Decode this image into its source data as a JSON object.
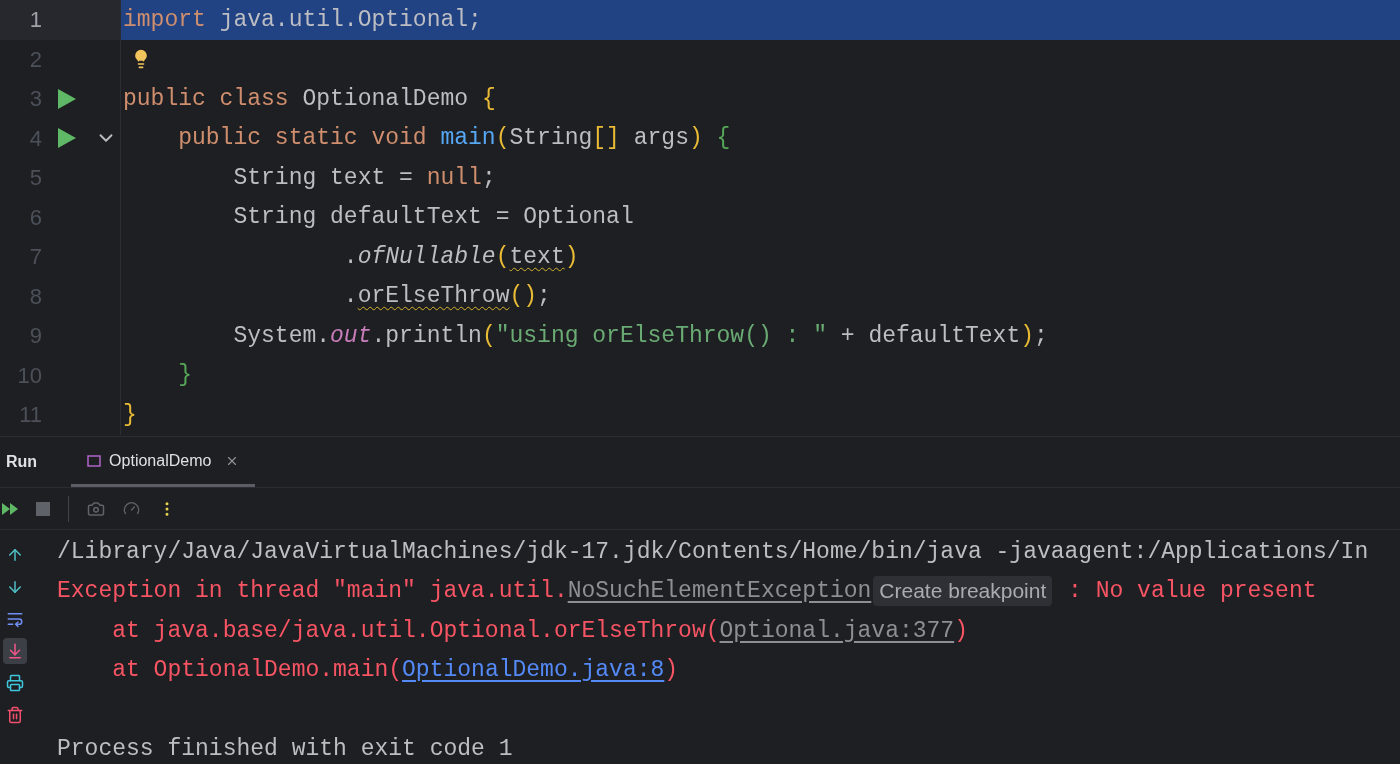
{
  "editor": {
    "lines": [
      {
        "number": "1",
        "selected": true,
        "run": false,
        "fold": false,
        "tokens": [
          {
            "text": "import",
            "kind": "keyword"
          },
          {
            "text": " java.util.Optional;",
            "kind": "plain"
          }
        ]
      },
      {
        "number": "2",
        "selected": false,
        "run": false,
        "fold": false,
        "bulb": true
      },
      {
        "number": "3",
        "selected": false,
        "run": true,
        "fold": false,
        "tokens": [
          {
            "text": "public class",
            "kind": "keyword"
          },
          {
            "text": " OptionalDemo ",
            "kind": "plain"
          },
          {
            "text": "{",
            "kind": "bracket1"
          }
        ]
      },
      {
        "number": "4",
        "selected": false,
        "run": true,
        "fold": true,
        "tokens": [
          {
            "text": "    public static void ",
            "kind": "keyword"
          },
          {
            "text": "main",
            "kind": "declaration"
          },
          {
            "text": "(",
            "kind": "bracket1"
          },
          {
            "text": "String",
            "kind": "plain"
          },
          {
            "text": "[]",
            "kind": "bracket1"
          },
          {
            "text": " args",
            "kind": "plain"
          },
          {
            "text": ")",
            "kind": "bracket1"
          },
          {
            "text": " {",
            "kind": "bracket2"
          }
        ]
      },
      {
        "number": "5",
        "selected": false,
        "run": false,
        "fold": false,
        "tokens": [
          {
            "text": "        String text = ",
            "kind": "plain"
          },
          {
            "text": "null",
            "kind": "keyword"
          },
          {
            "text": ";",
            "kind": "plain"
          }
        ]
      },
      {
        "number": "6",
        "selected": false,
        "run": false,
        "fold": false,
        "tokens": [
          {
            "text": "        String defaultText = Optional",
            "kind": "plain"
          }
        ]
      },
      {
        "number": "7",
        "selected": false,
        "run": false,
        "fold": false,
        "tokens": [
          {
            "text": "                .",
            "kind": "plain"
          },
          {
            "text": "ofNullable",
            "kind": "call"
          },
          {
            "text": "(",
            "kind": "bracket1"
          },
          {
            "text": "text",
            "kind": "plain",
            "warning": true
          },
          {
            "text": ")",
            "kind": "bracket1"
          }
        ]
      },
      {
        "number": "8",
        "selected": false,
        "run": false,
        "fold": false,
        "tokens": [
          {
            "text": "                .",
            "kind": "plain"
          },
          {
            "text": "orElseThrow",
            "kind": "plain",
            "warning": true
          },
          {
            "text": "()",
            "kind": "bracket1"
          },
          {
            "text": ";",
            "kind": "plain"
          }
        ]
      },
      {
        "number": "9",
        "selected": false,
        "run": false,
        "fold": false,
        "tokens": [
          {
            "text": "        System.",
            "kind": "plain"
          },
          {
            "text": "out",
            "kind": "field"
          },
          {
            "text": ".println",
            "kind": "plain"
          },
          {
            "text": "(",
            "kind": "bracket1"
          },
          {
            "text": "\"using orElseThrow() : \"",
            "kind": "string"
          },
          {
            "text": " + defaultText",
            "kind": "plain"
          },
          {
            "text": ")",
            "kind": "bracket1"
          },
          {
            "text": ";",
            "kind": "plain"
          }
        ]
      },
      {
        "number": "10",
        "selected": false,
        "run": false,
        "fold": false,
        "tokens": [
          {
            "text": "    }",
            "kind": "bracket2"
          }
        ]
      },
      {
        "number": "11",
        "selected": false,
        "run": false,
        "fold": false,
        "tokens": [
          {
            "text": "}",
            "kind": "bracket1"
          }
        ]
      }
    ]
  },
  "run_panel": {
    "title": "Run",
    "tabs": [
      {
        "label": "OptionalDemo",
        "selected": true
      }
    ],
    "toolbar": [
      {
        "kind": "rerun",
        "disabled": false
      },
      {
        "kind": "stop",
        "disabled": true
      },
      {
        "kind": "separator"
      },
      {
        "kind": "camera",
        "disabled": true
      },
      {
        "kind": "gauge",
        "disabled": true
      },
      {
        "kind": "more",
        "disabled": false
      }
    ],
    "side_tools": [
      {
        "kind": "up",
        "selected": false
      },
      {
        "kind": "down",
        "selected": false
      },
      {
        "kind": "wrap",
        "selected": false
      },
      {
        "kind": "scroll_end",
        "selected": true
      },
      {
        "kind": "print",
        "selected": false
      },
      {
        "kind": "clear",
        "selected": false
      }
    ],
    "console": [
      {
        "segments": [
          {
            "text": "/Library/Java/JavaVirtualMachines/jdk-17.jdk/Contents/Home/bin/java -javaagent:/Applications/In",
            "kind": "plain"
          }
        ]
      },
      {
        "segments": [
          {
            "text": "Exception in thread \"main\" java.util.",
            "kind": "error"
          },
          {
            "text": "NoSuchElementException",
            "kind": "link"
          },
          {
            "text": "Create breakpoint",
            "kind": "badge"
          },
          {
            "text": " : No value present",
            "kind": "error"
          }
        ]
      },
      {
        "segments": [
          {
            "text": "    at java.base/java.util.Optional.orElseThrow(",
            "kind": "error"
          },
          {
            "text": "Optional.java:377",
            "kind": "link"
          },
          {
            "text": ")",
            "kind": "error"
          }
        ]
      },
      {
        "segments": [
          {
            "text": "    at OptionalDemo.main(",
            "kind": "error"
          },
          {
            "text": "OptionalDemo.java:8",
            "kind": "source_link"
          },
          {
            "text": ")",
            "kind": "error"
          }
        ]
      },
      {
        "gap_before": true,
        "segments": [
          {
            "text": "Process finished with exit code 1",
            "kind": "plain"
          }
        ]
      }
    ]
  }
}
